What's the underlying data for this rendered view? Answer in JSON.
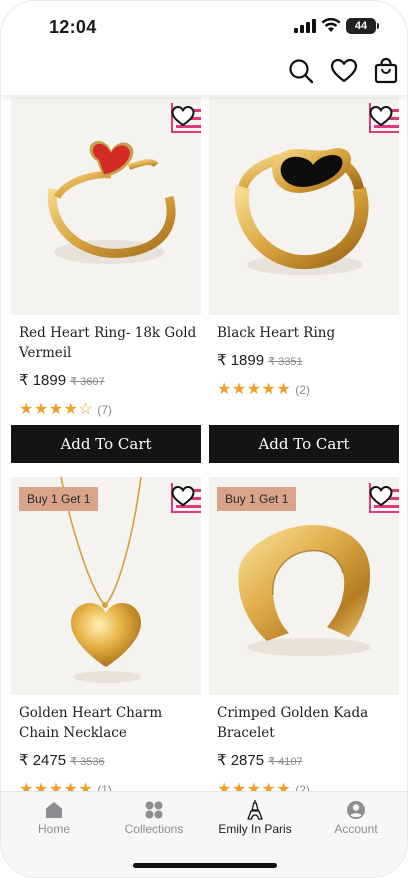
{
  "status_bar": {
    "time": "12:04",
    "battery": "44"
  },
  "header": {
    "icons": [
      "search-icon",
      "heart-icon",
      "shopping-bag-icon"
    ]
  },
  "products": [
    {
      "title": "Red Heart Ring- 18k Gold Vermeil",
      "price": "₹ 1899",
      "old_price": "₹ 3607",
      "stars": "★★★★☆",
      "rating": 4.5,
      "review_count": "(7)",
      "badge": "",
      "cta": "Add To Cart"
    },
    {
      "title": "Black Heart Ring",
      "price": "₹ 1899",
      "old_price": "₹ 3351",
      "stars": "★★★★★",
      "rating": 5,
      "review_count": "(2)",
      "badge": "",
      "cta": "Add To Cart"
    },
    {
      "title": "Golden Heart Charm Chain Necklace",
      "price": "₹ 2475",
      "old_price": "₹ 3536",
      "stars": "★★★★★",
      "rating": 5,
      "review_count": "(1)",
      "badge": "Buy 1 Get 1",
      "cta": ""
    },
    {
      "title": "Crimped Golden Kada Bracelet",
      "price": "₹ 2875",
      "old_price": "₹ 4107",
      "stars": "★★★★★",
      "rating": 5,
      "review_count": "(2)",
      "badge": "Buy 1 Get 1",
      "cta": ""
    }
  ],
  "nav": [
    {
      "label": "Home",
      "icon": "home-icon",
      "active": false
    },
    {
      "label": "Collections",
      "icon": "collections-icon",
      "active": false
    },
    {
      "label": "Emily In Paris",
      "icon": "eiffel-tower-icon",
      "active": true
    },
    {
      "label": "Account",
      "icon": "account-icon",
      "active": false
    }
  ],
  "colors": {
    "accent": "#141414",
    "star": "#f0a02a",
    "badge": "#d8a48a",
    "brand_pink": "#e0377f"
  }
}
